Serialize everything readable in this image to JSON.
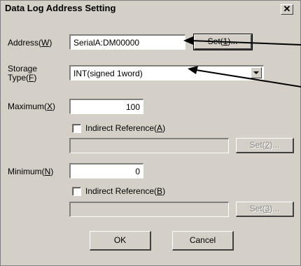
{
  "window": {
    "title": "Data Log Address Setting",
    "close_glyph": "✕"
  },
  "address": {
    "label": "Address(",
    "mnemonic": "W",
    "label_end": ")",
    "value": "SerialA:DM00000",
    "set_label": "Set(",
    "set_mnemonic": "1",
    "set_end": ")..."
  },
  "storage": {
    "label_line1": "Storage",
    "label_line2": "Type(",
    "mnemonic": "F",
    "label_end": ")",
    "selected": "INT(signed 1word)"
  },
  "maximum": {
    "label": "Maximum(",
    "mnemonic": "X",
    "label_end": ")",
    "value": "100",
    "indirect_label": "Indirect Reference(",
    "indirect_mnemonic": "A",
    "indirect_end": ")",
    "indirect_checked": false,
    "set_label": "Set(",
    "set_mnemonic": "2",
    "set_end": ")..."
  },
  "minimum": {
    "label": "Minimum(",
    "mnemonic": "N",
    "label_end": ")",
    "value": "0",
    "indirect_label": "Indirect Reference(",
    "indirect_mnemonic": "B",
    "indirect_end": ")",
    "indirect_checked": false,
    "set_label": "Set(",
    "set_mnemonic": "3",
    "set_end": ")..."
  },
  "footer": {
    "ok_label": "OK",
    "cancel_label": "Cancel"
  },
  "colors": {
    "face": "#d4d0c8",
    "shadow": "#808080",
    "dark": "#404040",
    "highlight": "#ffffff"
  }
}
